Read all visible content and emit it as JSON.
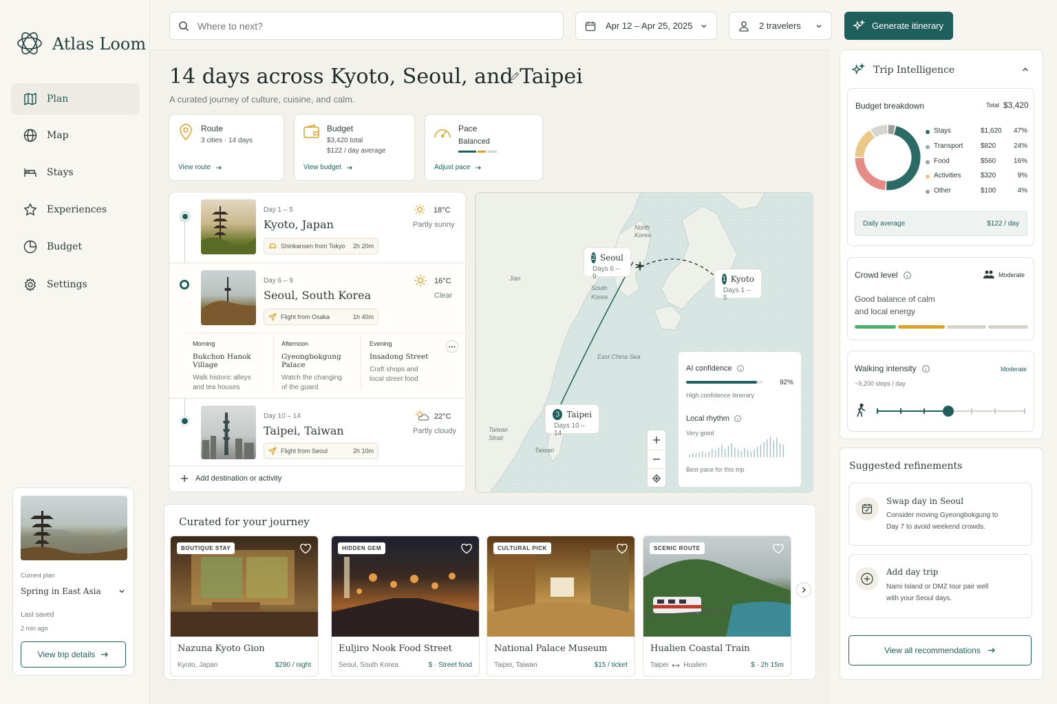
{
  "app": {
    "name": "Atlas Loom"
  },
  "sidebar": {
    "items": [
      {
        "label": "Plan"
      },
      {
        "label": "Map"
      },
      {
        "label": "Stays"
      },
      {
        "label": "Experiences"
      },
      {
        "label": "Budget"
      },
      {
        "label": "Settings"
      }
    ],
    "current_plan_label": "Current plan",
    "current_plan": "Spring in East Asia",
    "last_saved_label": "Last saved",
    "last_saved": "2 min ago",
    "view_details": "View trip details"
  },
  "topbar": {
    "search_placeholder": "Where to next?",
    "dates": "Apr 12 – Apr 25, 2025",
    "travelers": "2 travelers",
    "generate": "Generate itinerary"
  },
  "trip": {
    "title": "14 days across Kyoto, Seoul, and Taipei",
    "subtitle": "A curated journey of culture, cuisine, and calm."
  },
  "stats": {
    "route": {
      "title": "Route",
      "cities": "3 cities",
      "days": "14 days",
      "link": "View route"
    },
    "budget": {
      "title": "Budget",
      "total": "$3,420 total",
      "daily": "$122 / day average",
      "link": "View budget"
    },
    "pace": {
      "title": "Pace",
      "value": "Balanced",
      "link": "Adjust pace"
    }
  },
  "destinations": [
    {
      "days": "Day 1 – 5",
      "name": "Kyoto, Japan",
      "temp": "18°C",
      "weather": "Partly sunny",
      "transport": "Shinkansen from Tokyo",
      "duration": "2h 20m"
    },
    {
      "days": "Day 6 – 9",
      "name": "Seoul, South Korea",
      "temp": "16°C",
      "weather": "Clear",
      "transport": "Flight from Osaka",
      "duration": "1h 40m"
    },
    {
      "days": "Day 10 – 14",
      "name": "Taipei, Taiwan",
      "temp": "22°C",
      "weather": "Partly cloudy",
      "transport": "Flight from Seoul",
      "duration": "2h 10m"
    }
  ],
  "seoul_plan": [
    {
      "period": "Morning",
      "place": "Bukchon Hanok Village",
      "desc1": "Walk historic alleys",
      "desc2": "and tea houses"
    },
    {
      "period": "Afternoon",
      "place": "Gyeongbokgung Palace",
      "desc1": "Watch the changing",
      "desc2": "of the guard"
    },
    {
      "period": "Evening",
      "place": "Insadong Street",
      "desc1": "Craft shops and",
      "desc2": "local street food"
    }
  ],
  "add_destination": "Add destination or activity",
  "map": {
    "labels": {
      "north_korea1": "North",
      "north_korea2": "Korea",
      "south_korea1": "South",
      "south_korea2": "Korea",
      "east_china_sea": "East China Sea",
      "taiwan_strait1": "Taiwan",
      "taiwan_strait2": "Strait",
      "taiwan": "Taiwan",
      "jian": "Jian"
    },
    "markers": [
      {
        "num": "2",
        "city": "Seoul",
        "days": "Days 6 – 9"
      },
      {
        "num": "1",
        "city": "Kyoto",
        "days": "Days 1 – 5"
      },
      {
        "num": "3",
        "city": "Taipei",
        "days": "Days 10 – 14"
      }
    ],
    "ai": {
      "title": "AI confidence",
      "value_label": "92%",
      "value": 0.92,
      "note": "High confidence itinerary",
      "rhythm_title": "Local rhythm",
      "rhythm_value": "Very good",
      "rhythm_note": "Best pace for this trip"
    }
  },
  "curated": {
    "title": "Curated for your journey",
    "items": [
      {
        "tag": "BOUTIQUE STAY",
        "name": "Nazuna Kyoto Gion",
        "loc": "Kyoto, Japan",
        "price": "$290 / night"
      },
      {
        "tag": "HIDDEN GEM",
        "name": "Euljiro Nook Food Street",
        "loc": "Seoul, South Korea",
        "price": "$ · Street food"
      },
      {
        "tag": "CULTURAL PICK",
        "name": "National Palace Museum",
        "loc": "Taipei, Taiwan",
        "price": "$15 / ticket"
      },
      {
        "tag": "SCENIC ROUTE",
        "name": "Hualien Coastal Train",
        "loc_a": "Taipei",
        "loc_b": "Hualien",
        "price": "$ · 2h 15m"
      }
    ]
  },
  "intel": {
    "title": "Trip Intelligence",
    "budget_title": "Budget breakdown",
    "total_label": "Total",
    "total": "$3,420",
    "breakdown": [
      {
        "name": "Stays",
        "amount": "$1,620",
        "pct": "47%",
        "share": 47,
        "color": "#2b6b66"
      },
      {
        "name": "Transport",
        "amount": "$820",
        "pct": "24%",
        "share": 24,
        "color": "#e58a85"
      },
      {
        "name": "Food",
        "amount": "$560",
        "pct": "16%",
        "share": 16,
        "color": "#ecc785"
      },
      {
        "name": "Activities",
        "amount": "$320",
        "pct": "9%",
        "share": 9,
        "color": "#d7d5d0"
      },
      {
        "name": "Other",
        "amount": "$100",
        "pct": "4%",
        "share": 4,
        "color": "#9aa19e"
      }
    ],
    "daily_label": "Daily average",
    "daily_value": "$122 / day",
    "crowd_title": "Crowd level",
    "crowd_value": "Moderate",
    "crowd_desc1": "Good balance of calm",
    "crowd_desc2": "and local energy",
    "walk_title": "Walking intensity",
    "walk_value": "Moderate",
    "walk_steps": "~9,200 steps / day",
    "walk_level": 0.48
  },
  "refinements": {
    "title": "Suggested refinements",
    "items": [
      {
        "title": "Swap day in Seoul",
        "desc1": "Consider moving Gyeongbokgung to",
        "desc2": "Day 7 to avoid weekend crowds."
      },
      {
        "title": "Add day trip",
        "desc1": "Nami Island or DMZ tour pair well",
        "desc2": "with your Seoul days."
      }
    ],
    "view_all": "View all recommendations"
  },
  "colors": {
    "accent": "#1f5f5b",
    "bg": "#f7f5f0",
    "gold": "#d9a227",
    "green": "#4caf6a"
  }
}
